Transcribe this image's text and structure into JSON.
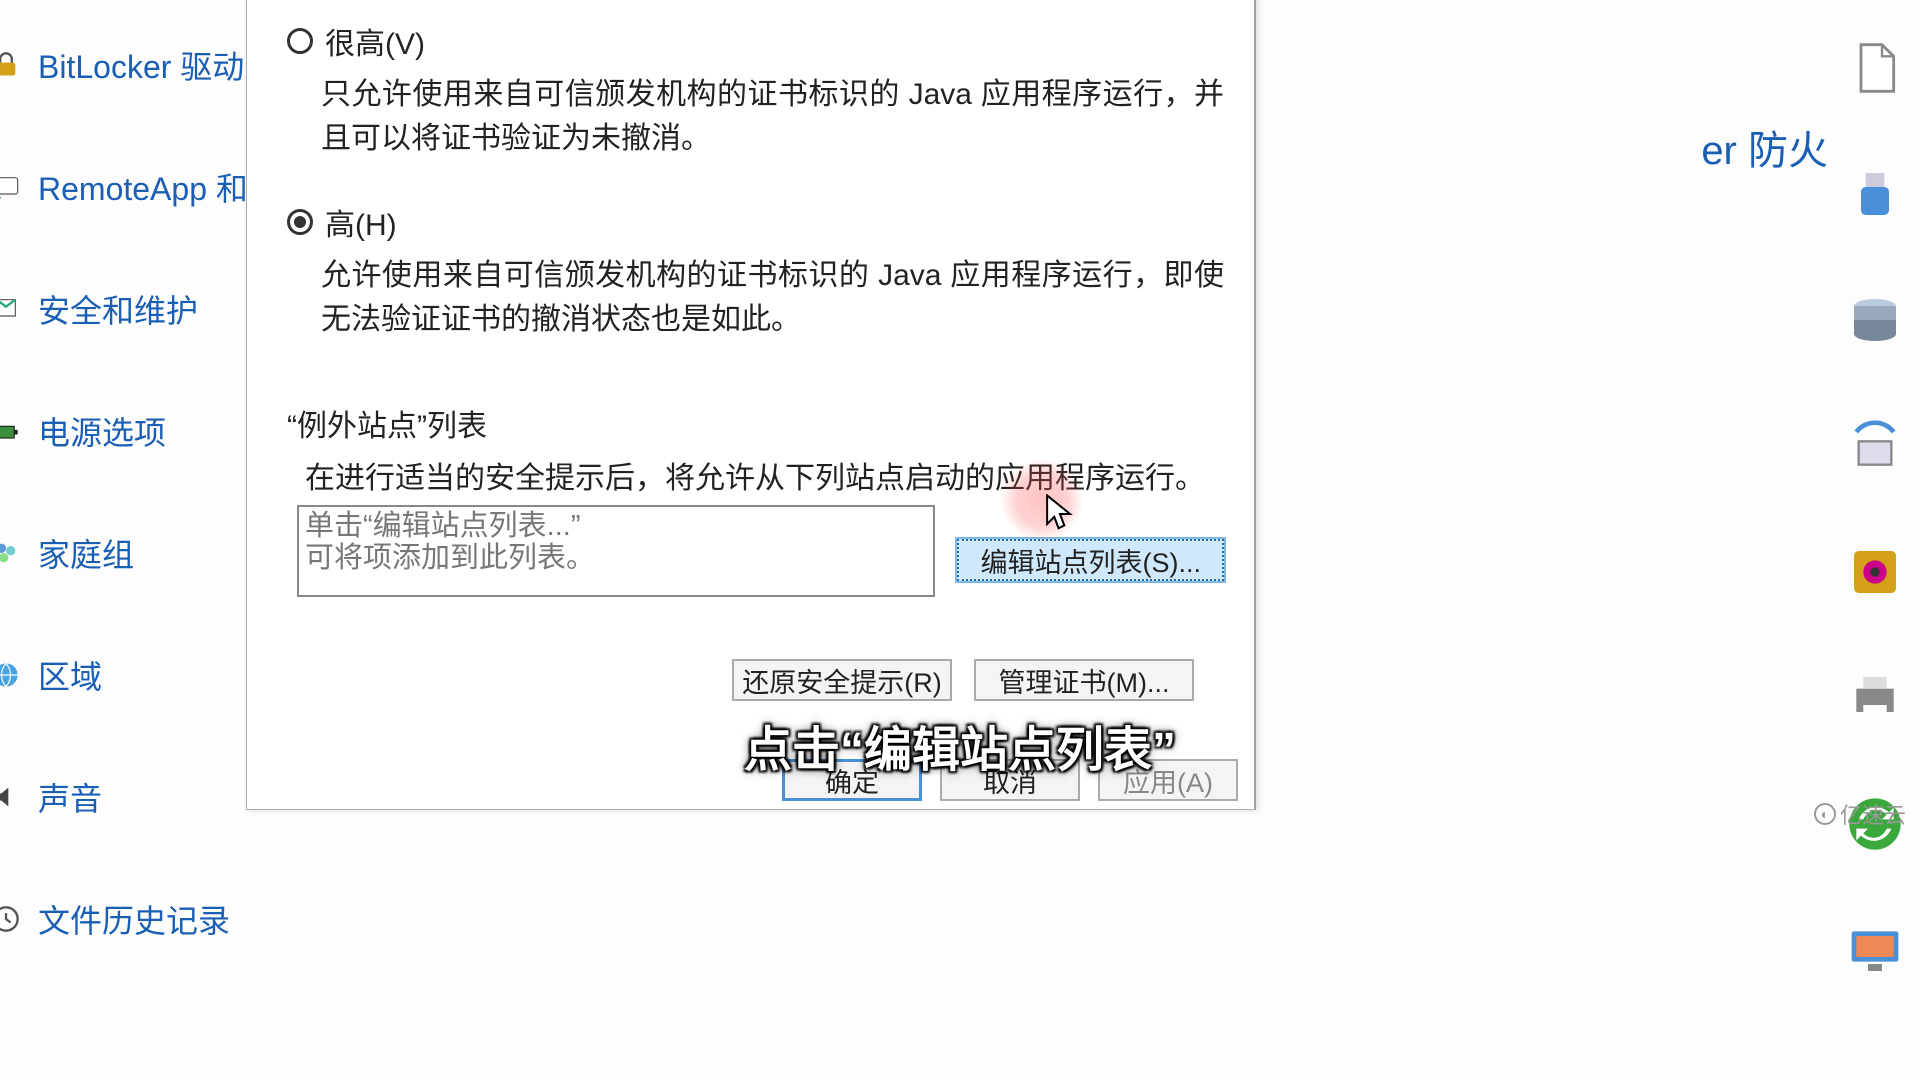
{
  "left_panel": {
    "items": [
      {
        "label": "BitLocker 驱动",
        "icon": "bitlocker-icon"
      },
      {
        "label": "RemoteApp 和",
        "icon": "remoteapp-icon"
      },
      {
        "label": "安全和维护",
        "icon": "security-maintenance-icon"
      },
      {
        "label": "电源选项",
        "icon": "power-options-icon"
      },
      {
        "label": "家庭组",
        "icon": "homegroup-icon"
      },
      {
        "label": "区域",
        "icon": "region-icon"
      },
      {
        "label": "声音",
        "icon": "sound-icon"
      },
      {
        "label": "文件历史记录",
        "icon": "file-history-icon"
      }
    ]
  },
  "right_crop_text": "er 防火",
  "right_icons": [
    "document-icon",
    "usb-icon",
    "disk-stack-icon",
    "wifi-router-icon",
    "safe-icon",
    "printer-icon",
    "sync-icon",
    "monitor-icon"
  ],
  "dialog": {
    "security_levels": {
      "very_high": {
        "label": "很高(V)",
        "desc": "只允许使用来自可信颁发机构的证书标识的 Java 应用程序运行，并且可以将证书验证为未撤消。",
        "checked": false
      },
      "high": {
        "label": "高(H)",
        "desc": "允许使用来自可信颁发机构的证书标识的 Java 应用程序运行，即使无法验证证书的撤消状态也是如此。",
        "checked": true
      }
    },
    "exception_section": {
      "title": "“例外站点”列表",
      "subtitle": "在进行适当的安全提示后，将允许从下列站点启动的应用程序运行。",
      "placeholder_line1": "单击“编辑站点列表...”",
      "placeholder_line2": "可将项添加到此列表。",
      "edit_button": "编辑站点列表(S)..."
    },
    "lower": {
      "restore": "还原安全提示(R)",
      "manage_cert": "管理证书(M)..."
    },
    "footer": {
      "ok": "确定",
      "cancel": "取消",
      "apply": "应用(A)"
    }
  },
  "subtitle": "点击“编辑站点列表”",
  "watermark": "亿速云"
}
